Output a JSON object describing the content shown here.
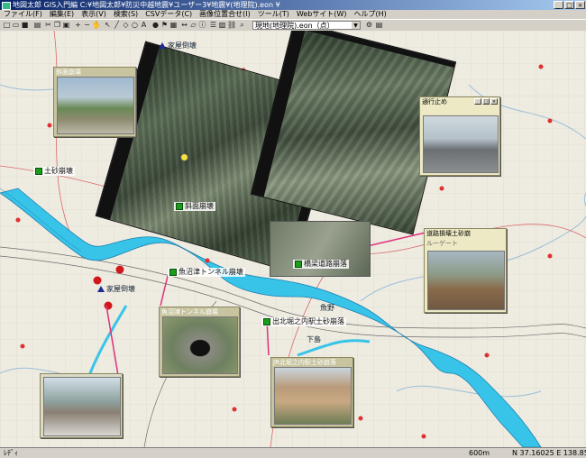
{
  "window": {
    "title": "地図太郎 GIS入門編  C:¥地図太郎¥防災中越地震¥ユーザー3¥地震¥(地理院).eon ¥",
    "buttons": [
      "_",
      "□",
      "×"
    ]
  },
  "menu": [
    "ファイル(F)",
    "編集(E)",
    "表示(V)",
    "検索(S)",
    "CSVデータ(C)",
    "画像位置合せ(I)",
    "ツール(T)",
    "Webサイト(W)",
    "ヘルプ(H)"
  ],
  "toolbar": {
    "layer_combo": "現地(地理院).eon（点）"
  },
  "labels": {
    "yabaki": "家屋倒壊",
    "yabaki2": "家屋倒壊",
    "doshaL": "土砂崩壊",
    "doshaC": "斜面崩壊",
    "tunnel": "魚沼津トンネル崩壊",
    "ekiLS": "出北堀之内駅土砂崩落",
    "roadR": "橋梁道路崩落",
    "river1": "魚野",
    "kanbara": "下島"
  },
  "photos": {
    "slope": "斜面崩壊",
    "closed": "通行止め",
    "road": "道路損壊土砂崩",
    "road_sub": "ルーゲート",
    "tunnel": "魚沼津トンネル崩壊",
    "ekiLS": "JR北堀之内駅土砂崩落"
  },
  "status": {
    "left": "ﾚﾃﾞｨ",
    "scale": "600m",
    "coords": "N 37.16025  E 138.85169"
  }
}
